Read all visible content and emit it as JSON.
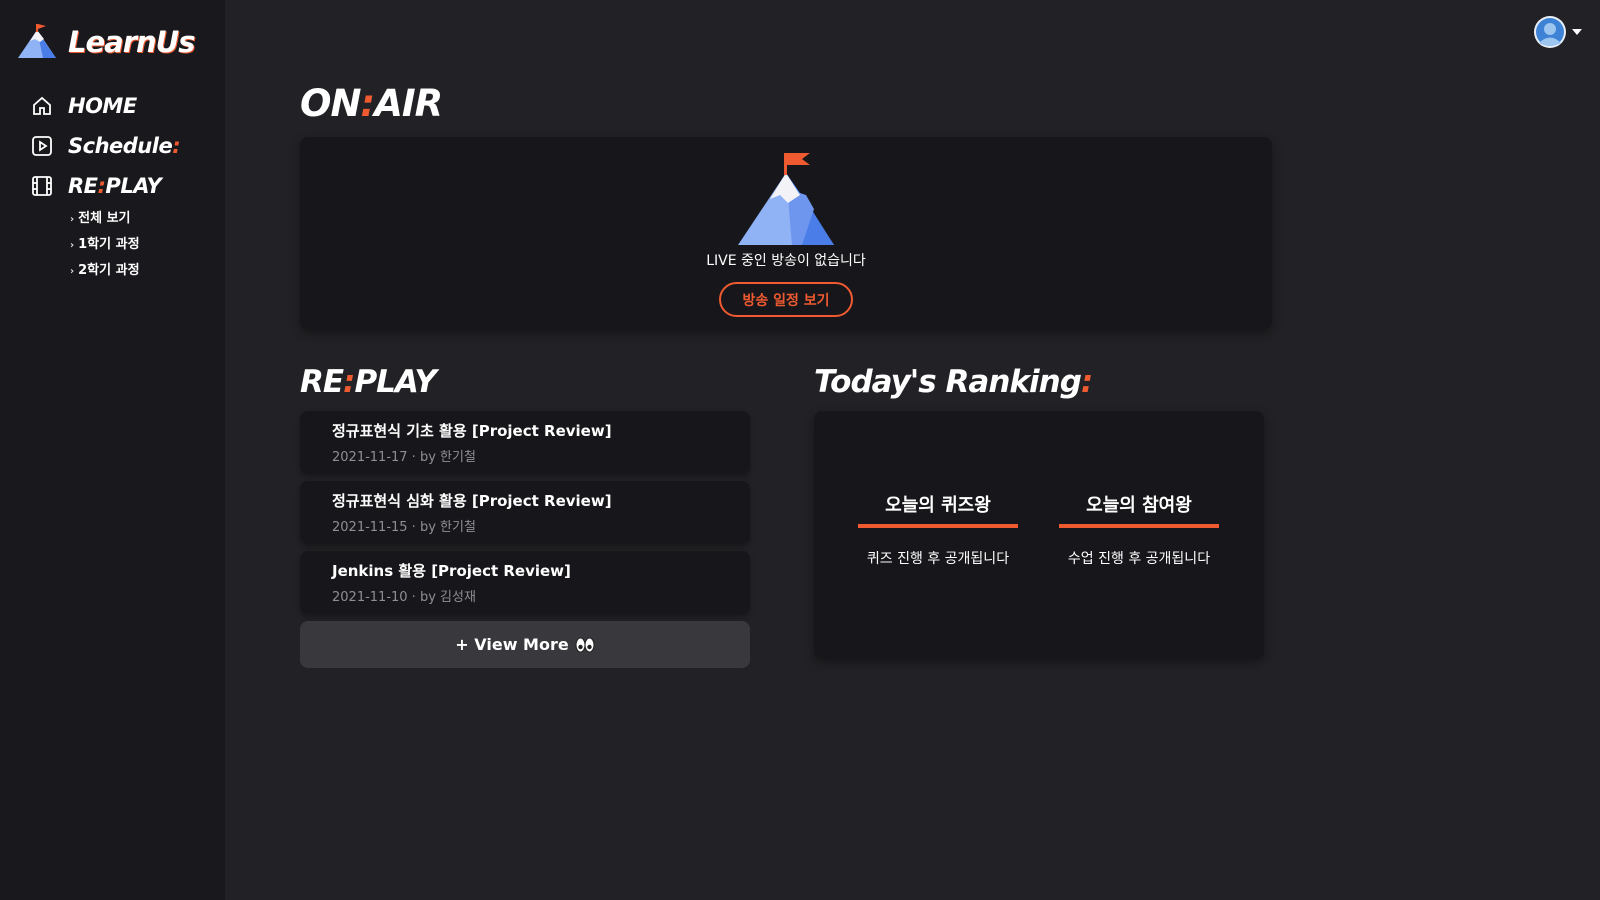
{
  "app": {
    "name": "LearnUs"
  },
  "sidebar": {
    "nav": [
      {
        "label": "HOME",
        "icon": "home-icon"
      },
      {
        "label": "Schedule",
        "accent": ":",
        "icon": "play-icon"
      },
      {
        "label_left": "RE",
        "accent": ":",
        "label_right": "PLAY",
        "icon": "film-icon"
      }
    ],
    "replay_sub": [
      {
        "label": "전체 보기"
      },
      {
        "label": "1학기 과정"
      },
      {
        "label": "2학기 과정"
      }
    ]
  },
  "onair": {
    "heading_left": "ON",
    "heading_accent": ":",
    "heading_right": "AIR",
    "message": "LIVE 중인 방송이 없습니다",
    "button_label": "방송 일정 보기"
  },
  "replay": {
    "heading_left": "RE",
    "heading_accent": ":",
    "heading_right": "PLAY",
    "items": [
      {
        "title": "정규표현식 기초 활용 [Project Review]",
        "meta": "2021-11-17 · by 한기철"
      },
      {
        "title": "정규표현식 심화 활용 [Project Review]",
        "meta": "2021-11-15 · by 한기철"
      },
      {
        "title": "Jenkins 활용 [Project Review]",
        "meta": "2021-11-10 · by 김성재"
      }
    ],
    "view_more_label": "+ View More"
  },
  "ranking": {
    "heading": "Today's Ranking",
    "heading_accent": ":",
    "columns": [
      {
        "title": "오늘의 퀴즈왕",
        "desc": "퀴즈 진행 후 공개됩니다"
      },
      {
        "title": "오늘의 참여왕",
        "desc": "수업 진행 후 공개됩니다"
      }
    ]
  },
  "colors": {
    "accent": "#ef5a30",
    "background": "#222226",
    "sidebar": "#19191d",
    "card": "#17171b"
  }
}
